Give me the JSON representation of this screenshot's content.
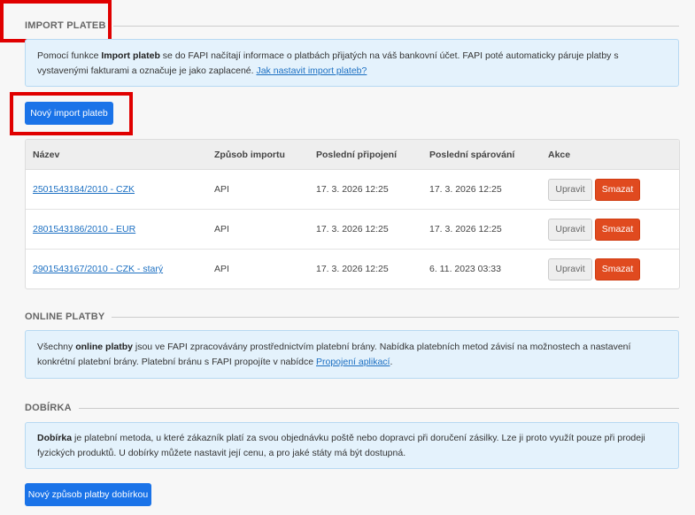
{
  "colors": {
    "primary": "#1a73e8",
    "danger": "#e04a1f",
    "info_bg": "#e4f2fc",
    "highlight": "#e00000"
  },
  "import": {
    "title": "IMPORT PLATEB",
    "info_pre": "Pomocí funkce ",
    "info_bold": "Import plateb",
    "info_mid": " se do FAPI načítají informace o platbách přijatých na váš bankovní účet. FAPI poté automaticky páruje platby s vystavenými fakturami a označuje je jako zaplacené. ",
    "info_link": "Jak nastavit import plateb?",
    "new_button": "Nový import plateb"
  },
  "table": {
    "headers": {
      "name": "Název",
      "method": "Způsob importu",
      "last_connect": "Poslední připojení",
      "last_pair": "Poslední spárování",
      "actions": "Akce"
    },
    "edit_label": "Upravit",
    "delete_label": "Smazat",
    "rows": [
      {
        "name": "2501543184/2010 - CZK",
        "method": "API",
        "last_connect": "17. 3. 2026 12:25",
        "last_pair": "17. 3. 2026 12:25"
      },
      {
        "name": "2801543186/2010 - EUR",
        "method": "API",
        "last_connect": "17. 3. 2026 12:25",
        "last_pair": "17. 3. 2026 12:25"
      },
      {
        "name": "2901543167/2010 - CZK - starý",
        "method": "API",
        "last_connect": "17. 3. 2026 12:25",
        "last_pair": "6. 11. 2023 03:33"
      }
    ]
  },
  "online": {
    "title": "ONLINE PLATBY",
    "info_pre": "Všechny ",
    "info_bold": "online platby",
    "info_mid": " jsou ve FAPI zpracovávány prostřednictvím platební brány. Nabídka platebních metod závisí na možnostech a nastavení konkrétní platební brány. Platební bránu s FAPI propojíte v nabídce ",
    "info_link": "Propojení aplikací",
    "info_post": "."
  },
  "cod": {
    "title": "DOBÍRKA",
    "info_bold": "Dobírka",
    "info_mid": " je platební metoda, u které zákazník platí za svou objednávku poště nebo dopravci při doručení zásilky. Lze ji proto využít pouze při prodeji fyzických produktů. U dobírky můžete nastavit její cenu, a pro jaké státy má být dostupná.",
    "new_button": "Nový způsob platby dobírkou"
  }
}
